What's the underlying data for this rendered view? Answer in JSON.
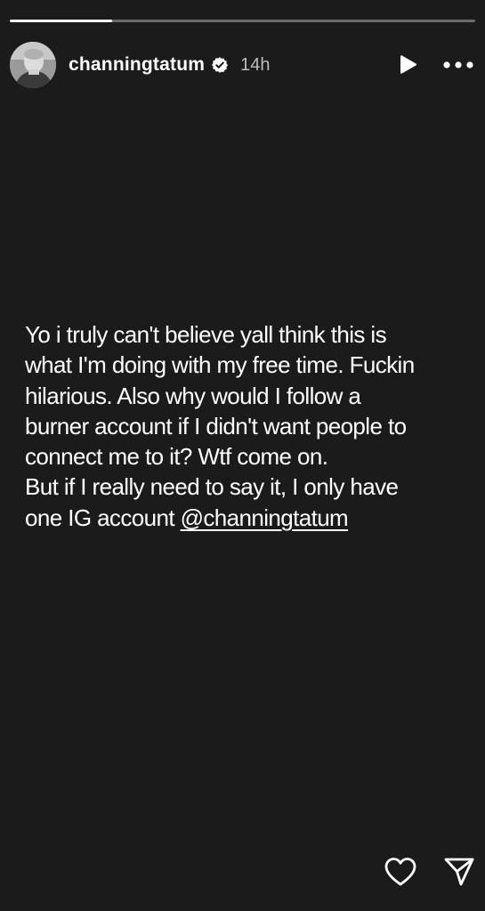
{
  "story": {
    "progress": 0.22,
    "username": "channingtatum",
    "timestamp": "14h",
    "lines": [
      "Yo i truly can't believe yall think this is",
      "what I'm doing with my free time. Fuckin",
      "hilarious. Also why would I follow a",
      "burner account if I didn't want people to",
      "connect me to it? Wtf come on.",
      "But if I really need to say it, I only have"
    ],
    "last_line_prefix": "one IG account ",
    "mention": "@channingtatum"
  },
  "icons": {
    "verified": "verified-badge-icon",
    "play": "play-icon",
    "more": "more-options-icon",
    "like": "heart-icon",
    "share": "send-icon"
  },
  "colors": {
    "background": "#1b1b1b",
    "text": "#ffffff",
    "timestamp": "#bdbdbd",
    "progress_track": "rgba(255,255,255,0.35)"
  }
}
